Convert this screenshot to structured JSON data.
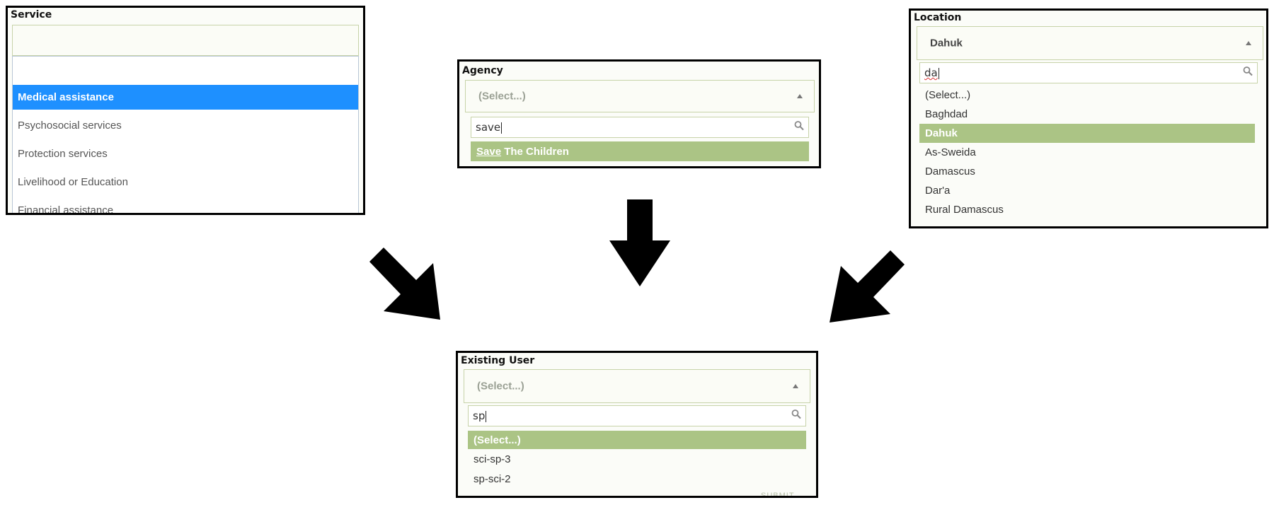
{
  "service": {
    "label": "Service",
    "options": [
      "Medical assistance",
      "Psychosocial services",
      "Protection services",
      "Livelihood or Education",
      "Financial assistance"
    ],
    "selected_index": 0
  },
  "agency": {
    "label": "Agency",
    "select_value": "(Select...)",
    "search_text": "save",
    "result_match": "Save",
    "result_rest": " The Children"
  },
  "location": {
    "label": "Location",
    "select_value": "Dahuk",
    "search_text": "da",
    "options": [
      "(Select...)",
      "Baghdad",
      "Dahuk",
      "As-Sweida",
      "Damascus",
      "Dar'a",
      "Rural Damascus"
    ],
    "selected_index": 2
  },
  "existing_user": {
    "label": "Existing User",
    "select_value": "(Select...)",
    "search_text": "sp",
    "options": [
      "(Select...)",
      "sci-sp-3",
      "sp-sci-2"
    ],
    "selected_index": 0,
    "submit_label": "SUBMIT"
  },
  "colors": {
    "highlight_green": "#abc485",
    "highlight_blue": "#1e90ff",
    "arrow": "#000000"
  }
}
